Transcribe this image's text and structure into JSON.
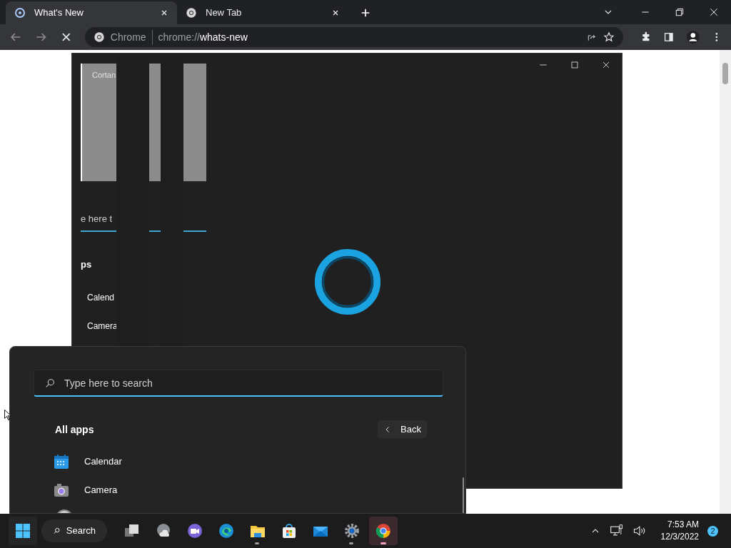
{
  "browser": {
    "tabs": [
      {
        "title": "What's New",
        "selected": true
      },
      {
        "title": "New Tab",
        "selected": false
      }
    ],
    "loading": true,
    "omnibox": {
      "site_label": "Chrome",
      "url_prefix": "chrome://",
      "url_host": "whats-new"
    }
  },
  "cortana_window": {
    "ghost": {
      "title": "Cortan",
      "search_text": "e here t",
      "heading": "ps",
      "apps": [
        "Calend",
        "Camera"
      ]
    }
  },
  "start_menu": {
    "search": {
      "placeholder": "Type here to search"
    },
    "heading": "All apps",
    "back_button": "Back",
    "apps": [
      {
        "name": "Calendar",
        "kind": "calendar"
      },
      {
        "name": "Camera",
        "kind": "camera"
      }
    ]
  },
  "taskbar": {
    "search_label": "Search",
    "apps": [
      {
        "kind": "task-view",
        "running": false,
        "selected": false
      },
      {
        "kind": "weather",
        "running": false,
        "selected": false
      },
      {
        "kind": "chat",
        "running": false,
        "selected": false
      },
      {
        "kind": "edge",
        "running": false,
        "selected": false
      },
      {
        "kind": "folder",
        "running": true,
        "selected": false
      },
      {
        "kind": "store",
        "running": false,
        "selected": false
      },
      {
        "kind": "mail",
        "running": false,
        "selected": false
      },
      {
        "kind": "settings",
        "running": true,
        "selected": false
      },
      {
        "kind": "chrome",
        "running": true,
        "selected": true
      }
    ],
    "time": "7:53 AM",
    "date": "12/3/2022",
    "notification_count": "2"
  }
}
